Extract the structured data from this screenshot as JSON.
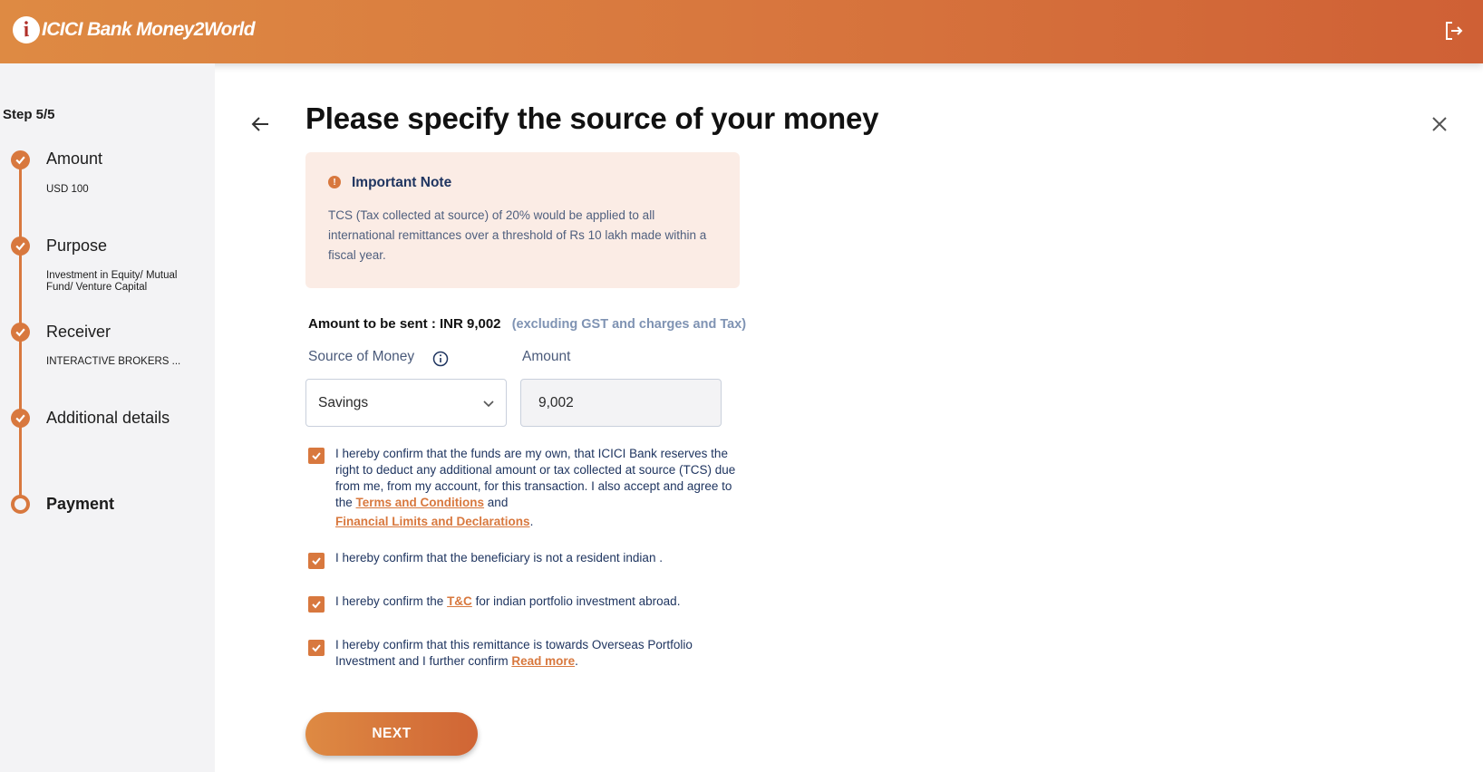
{
  "header": {
    "logo_mark": "i",
    "logo_text": "ICICI Bank Money2World",
    "logout_icon": "logout-icon"
  },
  "sidebar": {
    "step_count": "Step 5/5",
    "steps": [
      {
        "title": "Amount",
        "sub": "USD 100",
        "status": "done"
      },
      {
        "title": "Purpose",
        "sub": "Investment in Equity/ Mutual Fund/ Venture Capital",
        "status": "done"
      },
      {
        "title": "Receiver",
        "sub": "INTERACTIVE BROKERS ...",
        "status": "done"
      },
      {
        "title": "Additional details",
        "sub": "",
        "status": "done"
      },
      {
        "title": "Payment",
        "sub": "",
        "status": "current"
      }
    ]
  },
  "main": {
    "title": "Please specify the source of your money",
    "note": {
      "title": "Important Note",
      "icon": "!",
      "body": "TCS (Tax collected at source) of 20% would be applied to all international remittances over a threshold of Rs 10 lakh made within a fiscal year."
    },
    "amount_to_send_label": "Amount to be sent : INR 9,002",
    "amount_to_send_note": "(excluding GST and charges and Tax)",
    "source_label": "Source of Money",
    "amount_label": "Amount",
    "source_value": "Savings",
    "amount_value": "9,002",
    "confirmations": {
      "c1_text_a": "I hereby confirm that the funds are my own, that ICICI Bank reserves the right to deduct any additional amount or tax collected at source (TCS) due from me, from my account, for this transaction. I also accept and agree to the ",
      "c1_link1": "Terms and Conditions",
      "c1_text_b": " and",
      "c1_link2": "Financial Limits and Declarations",
      "c1_text_c": ".",
      "c2_text": "I hereby confirm that the beneficiary is not a resident indian .",
      "c3_text_a": "I hereby confirm the ",
      "c3_link": "T&C",
      "c3_text_b": " for indian portfolio investment abroad.",
      "c4_text_a": "I hereby confirm that this remittance is towards Overseas Portfolio Investment and I further confirm ",
      "c4_link": "Read more",
      "c4_text_b": "."
    },
    "next_label": "NEXT"
  },
  "colors": {
    "accent": "#d8783e",
    "header_start": "#de8a43",
    "header_end": "#cf6035",
    "note_bg": "#fbece5",
    "sidebar_bg": "#f3f3f5"
  }
}
